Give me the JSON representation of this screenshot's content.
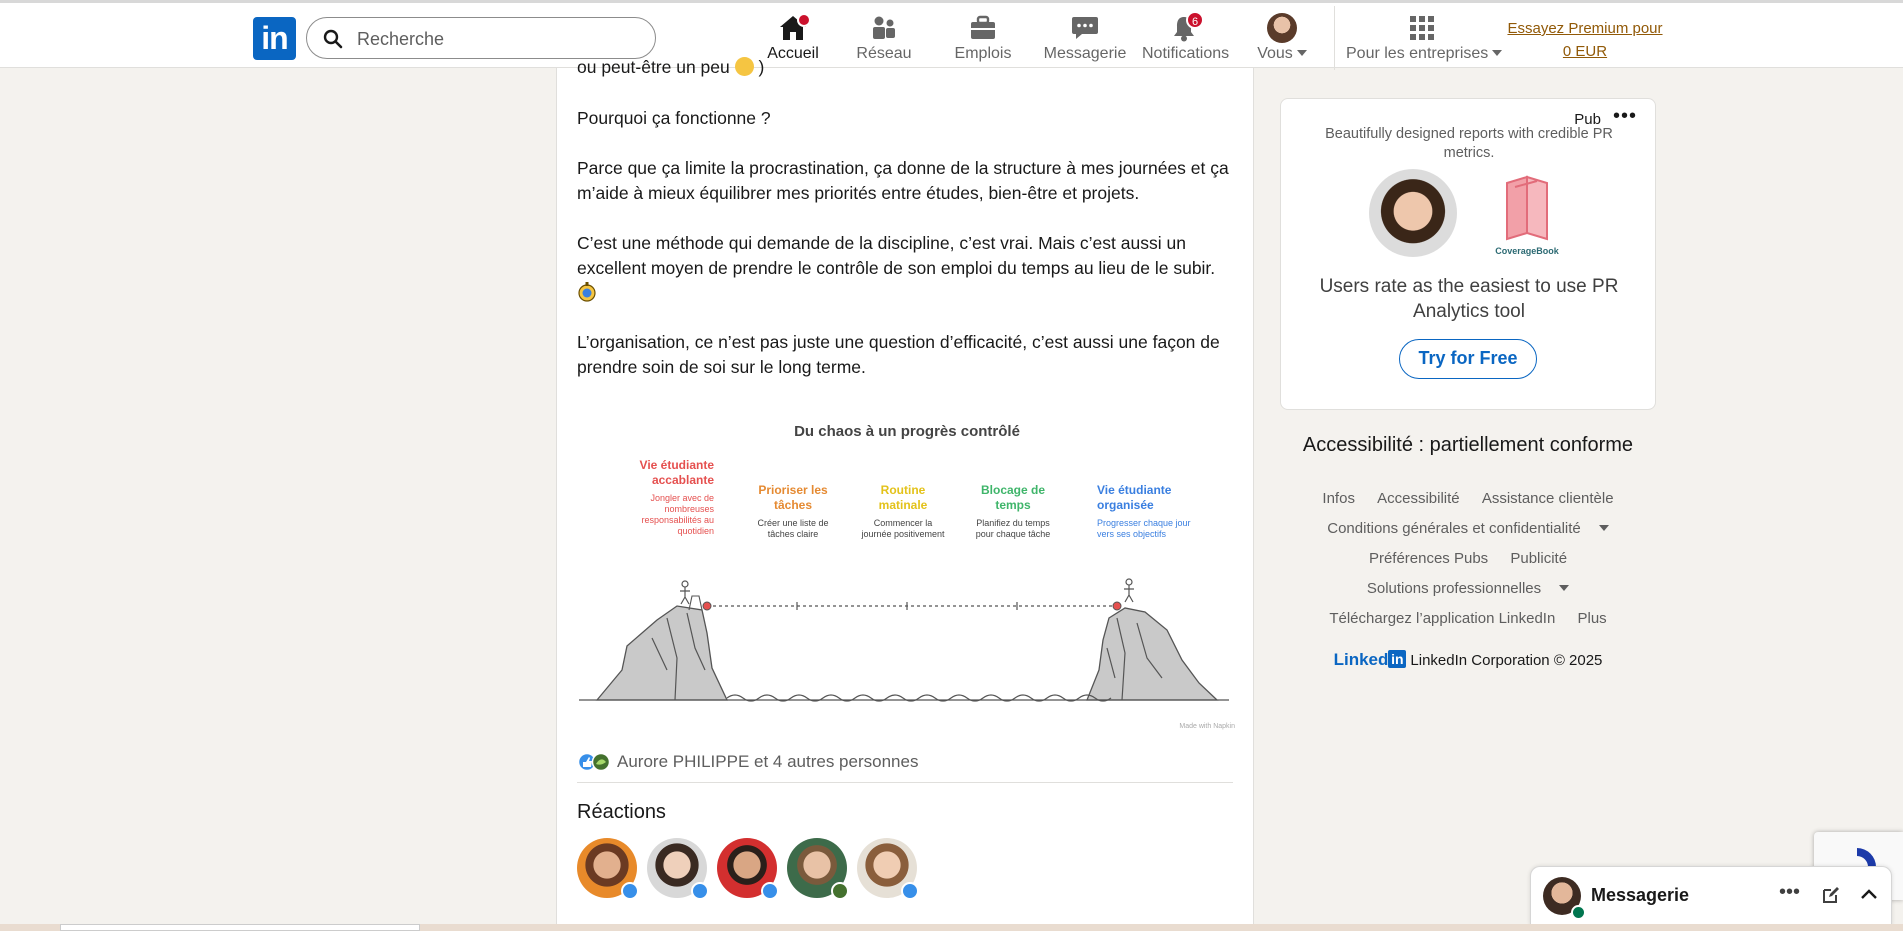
{
  "nav": {
    "search_placeholder": "Recherche",
    "items": [
      {
        "label": "Accueil",
        "icon": "home-icon",
        "badge": ""
      },
      {
        "label": "Réseau",
        "icon": "network-icon",
        "badge": ""
      },
      {
        "label": "Emplois",
        "icon": "briefcase-icon",
        "badge": ""
      },
      {
        "label": "Messagerie",
        "icon": "chat-icon",
        "badge": ""
      },
      {
        "label": "Notifications",
        "icon": "bell-icon",
        "badge": "6"
      },
      {
        "label": "Vous",
        "icon": "avatar",
        "badge": ""
      },
      {
        "label": "Pour les entreprises",
        "icon": "grid-icon",
        "badge": ""
      }
    ],
    "premium_line1": "Essayez Premium pour",
    "premium_line2": "0 EUR",
    "colors": {
      "brand": "#0a66c2",
      "badge": "#cb112d",
      "premium": "#915907"
    }
  },
  "post": {
    "cut_line": "ou peut-être un peu",
    "p1": "Pourquoi ça fonctionne ?",
    "p2": "Parce que ça limite la procrastination, ça donne de la structure à mes journées et ça m’aide à mieux équilibrer mes priorités entre études, bien-être et projets.",
    "p3": "C’est une méthode qui demande de la discipline, c’est vrai. Mais c’est aussi un excellent moyen de prendre le contrôle de son emploi du temps au lieu de le subir.",
    "p4": "L’organisation, ce n’est pas juste une question d’efficacité, c’est aussi une façon de prendre soin de soi sur le long terme.",
    "infographic": {
      "title": "Du chaos à un progrès contrôlé",
      "stages": [
        {
          "title1": "Vie étudiante",
          "title2": "accablante",
          "desc": [
            "Jongler avec de",
            "nombreuses",
            "responsabilités au",
            "quotidien"
          ],
          "color": "#e5504f"
        },
        {
          "title1": "Prioriser les",
          "title2": "tâches",
          "desc": [
            "Créer une liste de",
            "tâches claire"
          ],
          "color": "#e58a32"
        },
        {
          "title1": "Routine",
          "title2": "matinale",
          "desc": [
            "Commencer la",
            "journée positivement"
          ],
          "color": "#e3c21a"
        },
        {
          "title1": "Blocage de",
          "title2": "temps",
          "desc": [
            "Planifiez du temps",
            "pour chaque tâche"
          ],
          "color": "#3fb56a"
        },
        {
          "title1": "Vie étudiante",
          "title2": "organisée",
          "desc": [
            "Progresser chaque jour",
            "vers ses objectifs"
          ],
          "color": "#3a7fe0"
        }
      ],
      "made_with": "Made with Napkin"
    },
    "reactions_summary": "Aurore PHILIPPE et 4 autres personnes",
    "reactions_title": "Réactions"
  },
  "ad": {
    "pub_label": "Pub",
    "description": "Beautifully designed reports with credible PR metrics.",
    "brand_name": "CoverageBook",
    "headline": "Users rate as the easiest to use PR Analytics tool",
    "cta": "Try for Free"
  },
  "footer": {
    "accessibility": "Accessibilité : partiellement conforme",
    "links_row1": [
      "Infos",
      "Accessibilité",
      "Assistance clientèle"
    ],
    "links_row2": "Conditions générales et confidentialité",
    "links_row3": [
      "Préférences Pubs",
      "Publicité"
    ],
    "links_row4": "Solutions professionnelles",
    "links_row5": [
      "Téléchargez l’application LinkedIn",
      "Plus"
    ],
    "brand_word": "Linked",
    "brand_box": "in",
    "copyright": "LinkedIn Corporation © 2025"
  },
  "messaging": {
    "title": "Messagerie"
  }
}
